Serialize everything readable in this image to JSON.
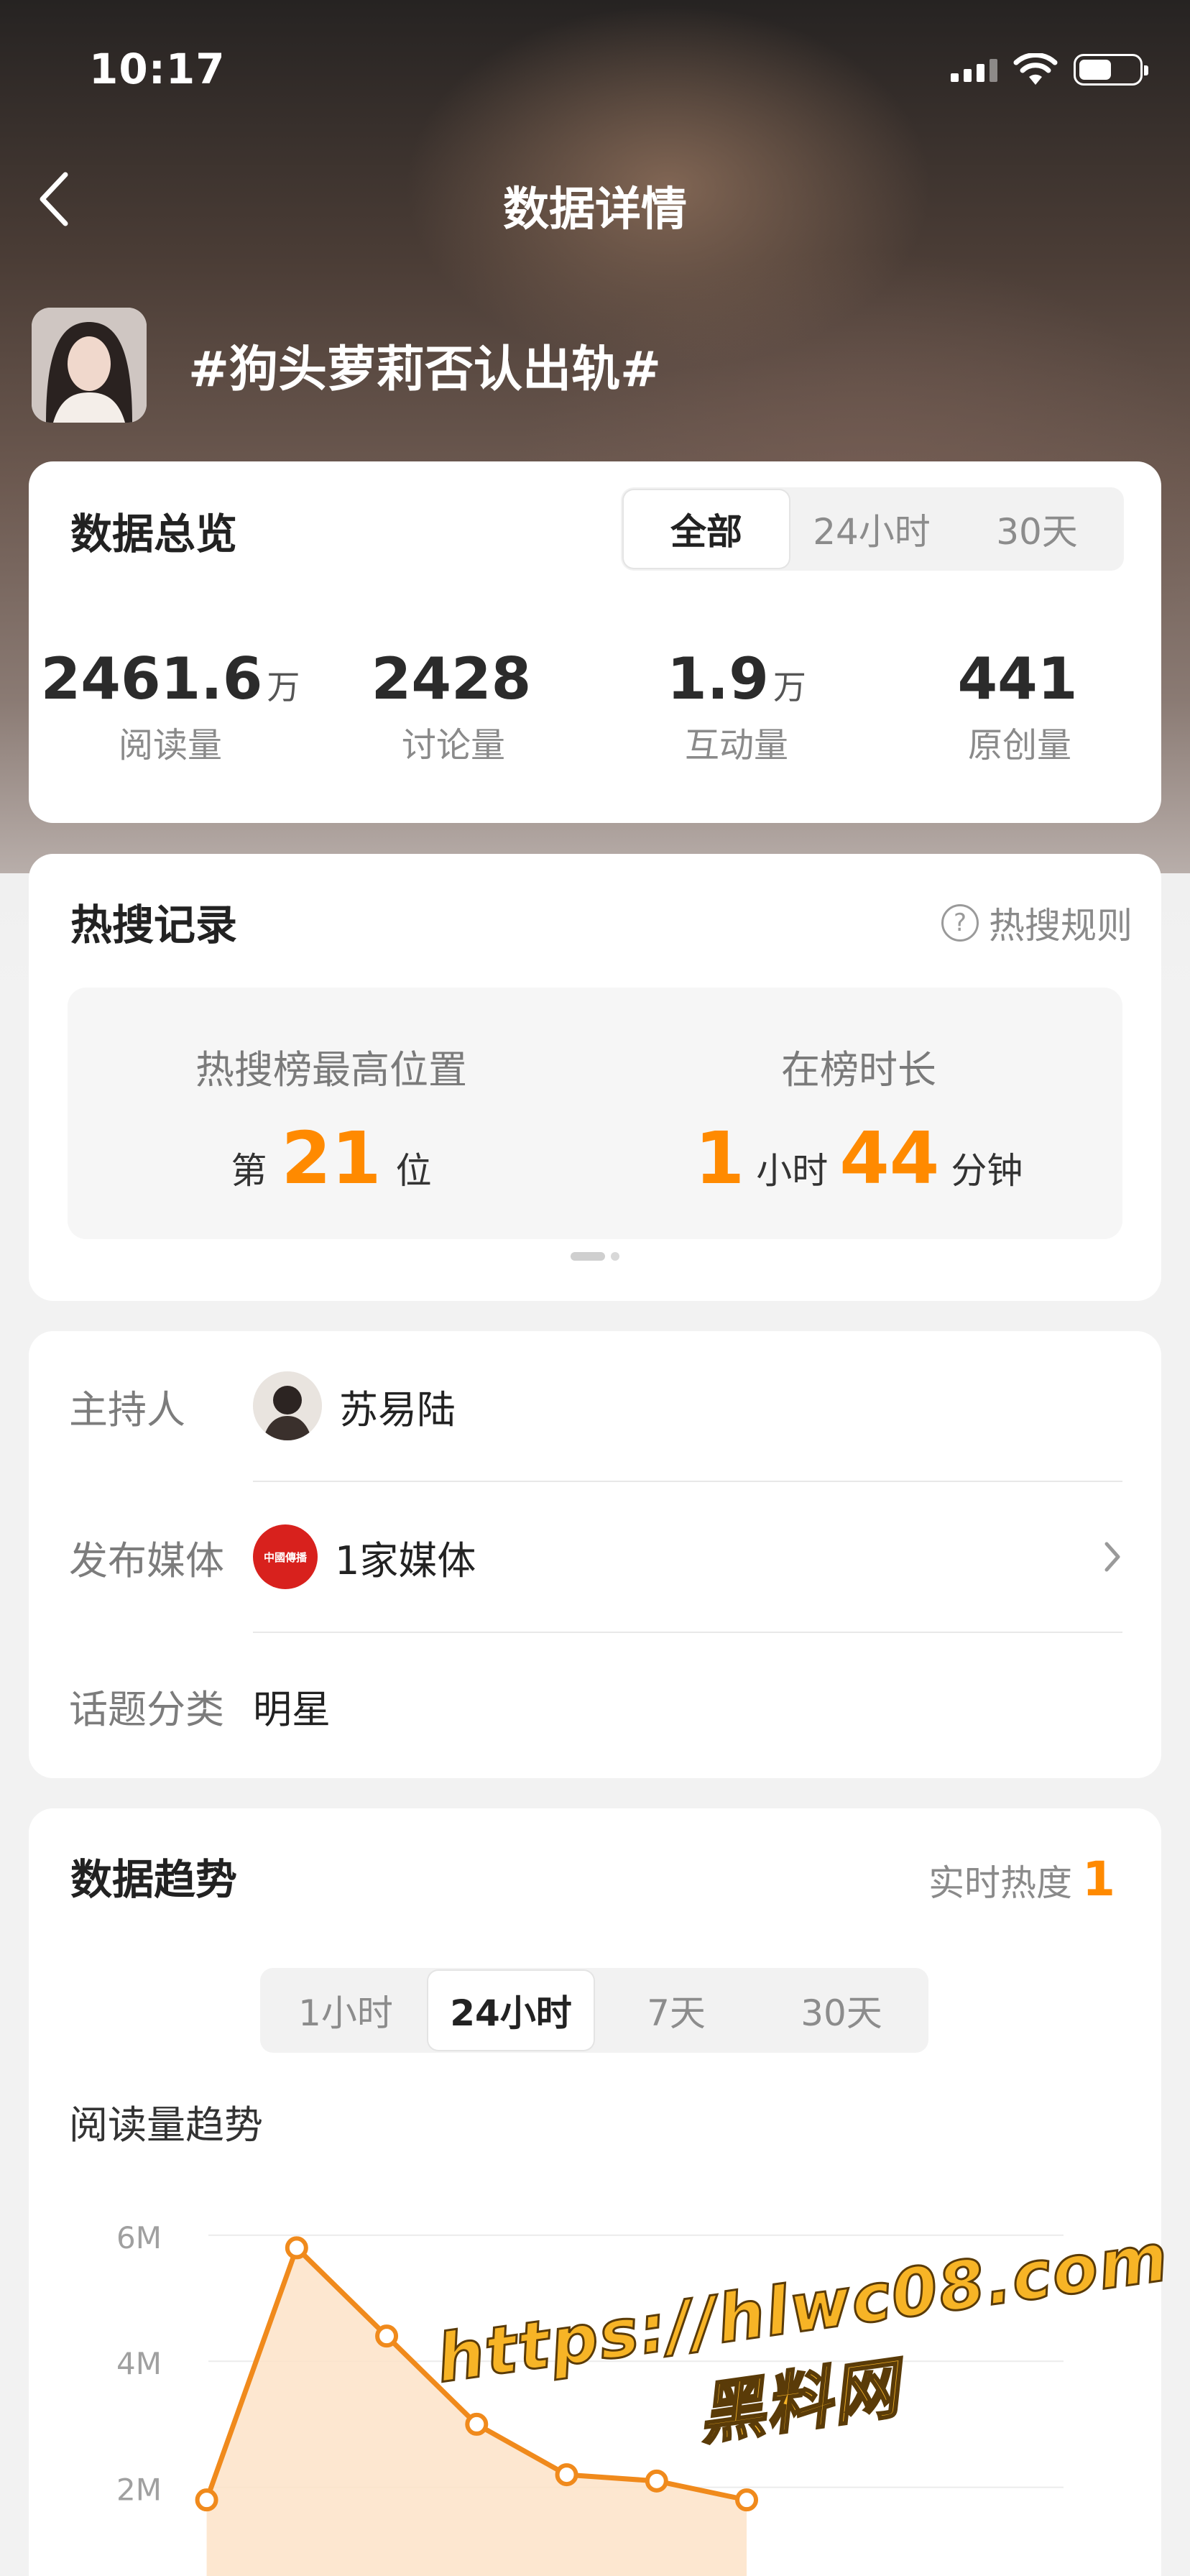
{
  "status_bar": {
    "time": "10:17"
  },
  "nav": {
    "title": "数据详情"
  },
  "topic": {
    "title": "#狗头萝莉否认出轨#"
  },
  "overview": {
    "title": "数据总览",
    "tabs": [
      "全部",
      "24小时",
      "30天"
    ],
    "active_tab": "全部",
    "stats": [
      {
        "value": "2461.6",
        "unit": "万",
        "label": "阅读量"
      },
      {
        "value": "2428",
        "unit": "",
        "label": "讨论量"
      },
      {
        "value": "1.9",
        "unit": "万",
        "label": "互动量"
      },
      {
        "value": "441",
        "unit": "",
        "label": "原创量"
      }
    ]
  },
  "hot_search": {
    "title": "热搜记录",
    "rules_link": "热搜规则",
    "highest": {
      "label": "热搜榜最高位置",
      "prefix": "第",
      "value": "21",
      "suffix": "位"
    },
    "duration": {
      "label": "在榜时长",
      "hours": "1",
      "hours_unit": "小时",
      "minutes": "44",
      "minutes_unit": "分钟"
    }
  },
  "info": {
    "host_label": "主持人",
    "host_name": "苏易陆",
    "media_label": "发布媒体",
    "media_value": "1家媒体",
    "media_logo_text": "中國傳播",
    "category_label": "话题分类",
    "category_value": "明星"
  },
  "trend": {
    "title": "数据趋势",
    "realtime_label": "实时热度",
    "realtime_value": "1",
    "tabs": [
      "1小时",
      "24小时",
      "7天",
      "30天"
    ],
    "active_tab": "24小时",
    "subtitle": "阅读量趋势"
  },
  "watermark": {
    "line1": "https://hlwc08.com",
    "line2": "黑料网"
  },
  "chart_data": {
    "type": "area",
    "title": "阅读量趋势",
    "ytick_labels": [
      "6M",
      "4M",
      "2M"
    ],
    "yticks": [
      6,
      4,
      2
    ],
    "ylim": [
      0,
      6.5
    ],
    "x": [
      1,
      2,
      3,
      4,
      5,
      6,
      7
    ],
    "series": [
      {
        "values": [
          1.8,
          5.8,
          4.4,
          3.0,
          2.2,
          2.1,
          1.8
        ]
      }
    ],
    "colors": {
      "line": "#f08a1c",
      "fill": "#fde3c8"
    }
  }
}
